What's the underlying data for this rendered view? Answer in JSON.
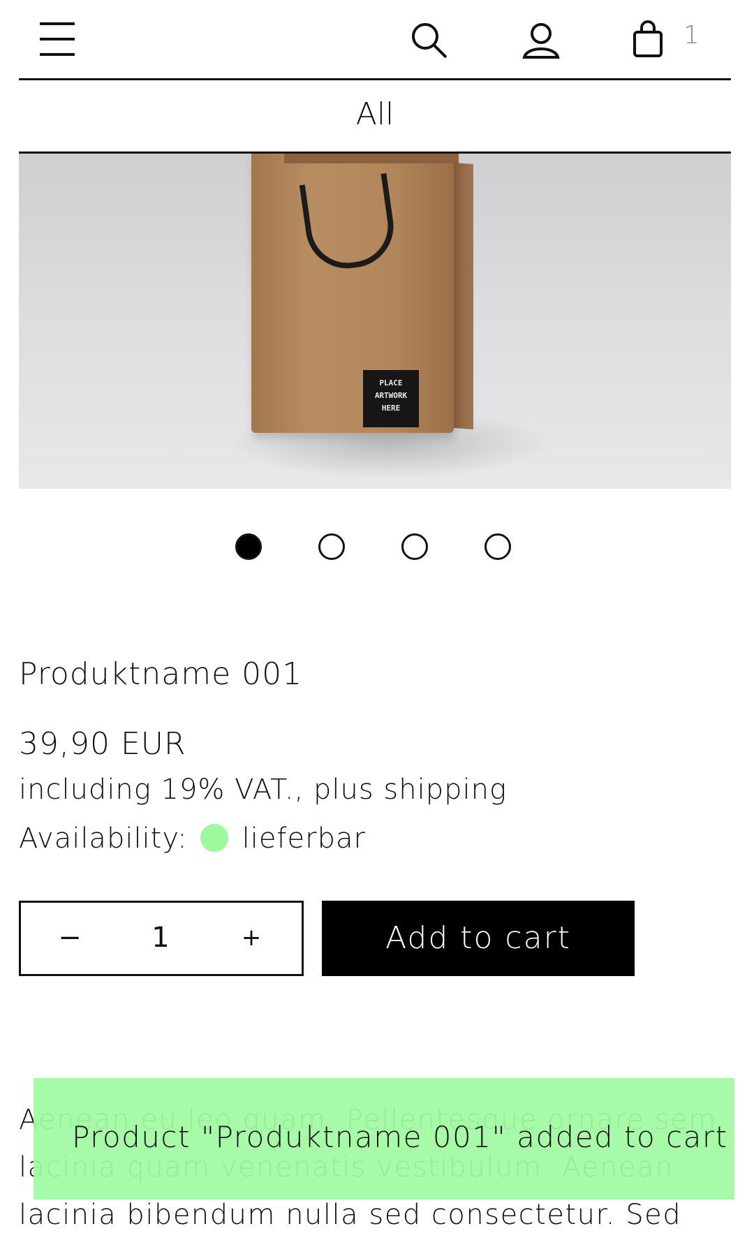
{
  "header": {
    "menu_icon": "hamburger-menu-icon",
    "search_icon": "search-icon",
    "account_icon": "user-icon",
    "cart_icon": "shopping-bag-icon",
    "cart_count": "1"
  },
  "category": {
    "label": "All"
  },
  "gallery": {
    "tag_text": "PLACE ARTWORK HERE",
    "slide_count": 4,
    "active_slide": 1
  },
  "product": {
    "name": "Produktname 001",
    "price": "39,90 EUR",
    "vat_note": "including 19% VAT., plus shipping",
    "availability_label": "Availability:",
    "availability_value": "lieferbar",
    "availability_color": "#9df99d"
  },
  "quantity": {
    "minus": "−",
    "value": "1",
    "plus": "+"
  },
  "add_to_cart_label": "Add to cart",
  "description": "Aenean eu leo quam. Pellentesque ornare sem lacinia quam venenatis vestibulum. Aenean lacinia bibendum nulla sed consectetur. Sed",
  "toast": {
    "message": "Product \"Produktname 001\" added to cart",
    "color": "#a0faa0"
  }
}
